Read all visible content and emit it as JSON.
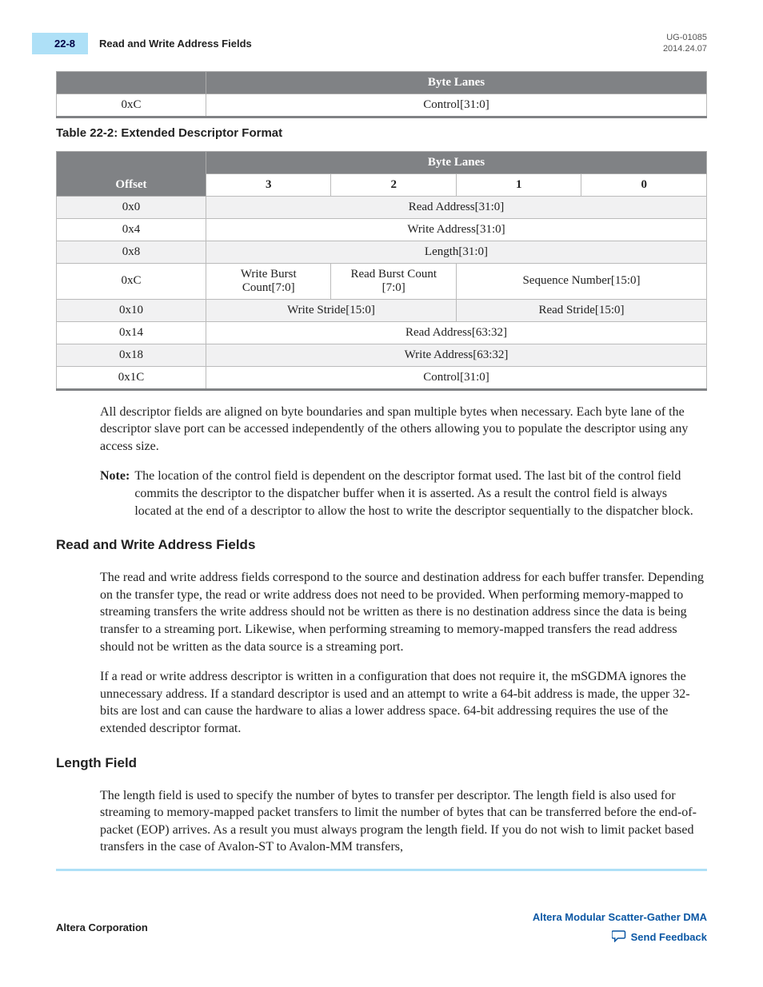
{
  "header": {
    "page_num": "22-8",
    "title": "Read and Write Address Fields",
    "doc_id": "UG-01085",
    "doc_date": "2014.24.07"
  },
  "table1": {
    "byte_lanes_header": "Byte Lanes",
    "row": {
      "offset": "0xC",
      "value": "Control[31:0]"
    }
  },
  "table2_caption": "Table 22-2: Extended Descriptor Format",
  "table2": {
    "byte_lanes_header": "Byte Lanes",
    "offset_header": "Offset",
    "col3": "3",
    "col2": "2",
    "col1": "1",
    "col0": "0",
    "rows": {
      "r0": {
        "offset": "0x0",
        "val": "Read Address[31:0]"
      },
      "r4": {
        "offset": "0x4",
        "val": "Write Address[31:0]"
      },
      "r8": {
        "offset": "0x8",
        "val": "Length[31:0]"
      },
      "rC": {
        "offset": "0xC",
        "c3": "Write Burst Count[7:0]",
        "c2": "Read Burst Count [7:0]",
        "c10": "Sequence Number[15:0]"
      },
      "r10": {
        "offset": "0x10",
        "c32": "Write Stride[15:0]",
        "c10": "Read Stride[15:0]"
      },
      "r14": {
        "offset": "0x14",
        "val": "Read Address[63:32]"
      },
      "r18": {
        "offset": "0x18",
        "val": "Write Address[63:32]"
      },
      "r1C": {
        "offset": "0x1C",
        "val": "Control[31:0]"
      }
    }
  },
  "para_after_tables": "All descriptor fields are aligned on byte boundaries and span multiple bytes when necessary. Each byte lane of the descriptor slave port can be accessed independently of the others allowing you to populate the descriptor using any access size.",
  "note": {
    "label": "Note:",
    "text": "The location of the control field is dependent on the descriptor format used. The last bit of the control field commits the descriptor to the dispatcher buffer when it is asserted. As a result the control field is always located at the end of a descriptor to allow the host to write the descriptor sequentially to the dispatcher block."
  },
  "section1": {
    "heading": "Read and Write Address Fields",
    "p1": "The read and write address fields correspond to the source and destination address for each buffer transfer. Depending on the transfer type, the read or write address does not need to be provided. When performing memory-mapped to streaming transfers the write address should not be written as there is no destination address since the data is being transfer to a streaming port. Likewise, when performing streaming to memory-mapped transfers the read address should not be written as the data source is a streaming port.",
    "p2": "If a read or write address descriptor is written in a configuration that does not require it, the mSGDMA ignores the unnecessary address. If a standard descriptor is used and an attempt to write a 64-bit address is made, the upper 32-bits are lost and can cause the hardware to alias a lower address space. 64-bit addressing requires the use of the extended descriptor format."
  },
  "section2": {
    "heading": "Length Field",
    "p1": "The length field is used to specify the number of bytes to transfer per descriptor. The length field is also used for streaming to memory-mapped packet transfers to limit the number of bytes that can be transferred before the end-of-packet (EOP) arrives. As a result you must always program the length field. If you do not wish to limit packet based transfers in the case of Avalon-ST to Avalon-MM transfers,"
  },
  "footer": {
    "left": "Altera Corporation",
    "right": "Altera Modular Scatter-Gather DMA",
    "feedback": "Send Feedback"
  }
}
